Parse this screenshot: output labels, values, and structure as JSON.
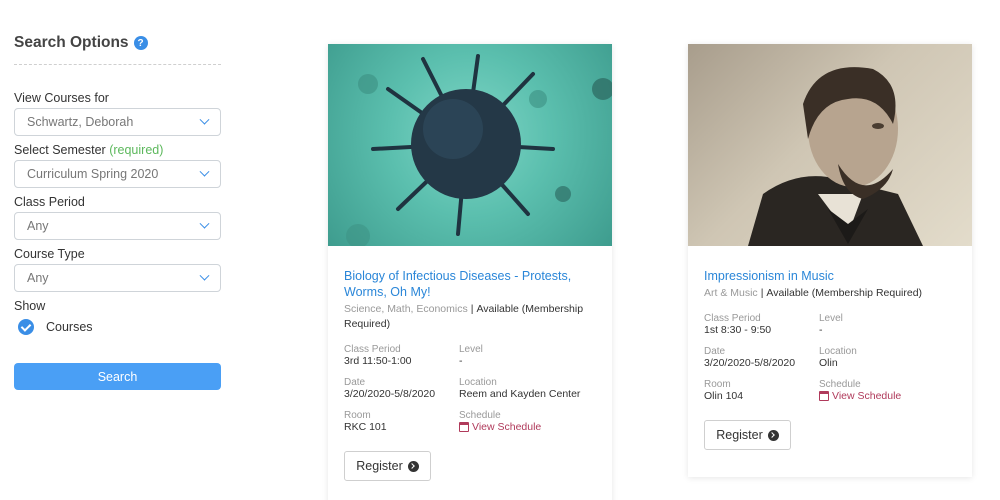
{
  "sidebar": {
    "title": "Search Options",
    "view_courses_label": "View Courses for",
    "view_courses_value": "Schwartz, Deborah",
    "semester_label": "Select Semester",
    "semester_required": "(required)",
    "semester_value": "Curriculum Spring 2020",
    "class_period_label": "Class Period",
    "class_period_value": "Any",
    "course_type_label": "Course Type",
    "course_type_value": "Any",
    "show_label": "Show",
    "show_option": "Courses",
    "search_button": "Search"
  },
  "courses": [
    {
      "title": "Biology of Infectious Diseases - Protests, Worms, Oh My!",
      "subjects": "Science, Math, Economics",
      "availability": "Available (Membership Required)",
      "class_period_label": "Class Period",
      "class_period": "3rd 11:50-1:00",
      "level_label": "Level",
      "level": "-",
      "date_label": "Date",
      "date": "3/20/2020-5/8/2020",
      "location_label": "Location",
      "location": "Reem and Kayden Center",
      "room_label": "Room",
      "room": "RKC 101",
      "schedule_label": "Schedule",
      "schedule_link": "View Schedule",
      "register_button": "Register"
    },
    {
      "title": "Impressionism in Music",
      "subjects": "Art & Music",
      "availability": "Available (Membership Required)",
      "class_period_label": "Class Period",
      "class_period": "1st 8:30 - 9:50",
      "level_label": "Level",
      "level": "-",
      "date_label": "Date",
      "date": "3/20/2020-5/8/2020",
      "location_label": "Location",
      "location": "Olin",
      "room_label": "Room",
      "room": "Olin 104",
      "schedule_label": "Schedule",
      "schedule_link": "View Schedule",
      "register_button": "Register"
    }
  ],
  "colors": {
    "accent": "#3a8ee6",
    "link": "#2a86d8",
    "schedule_link": "#b03a5b",
    "required": "#5cb85c"
  }
}
